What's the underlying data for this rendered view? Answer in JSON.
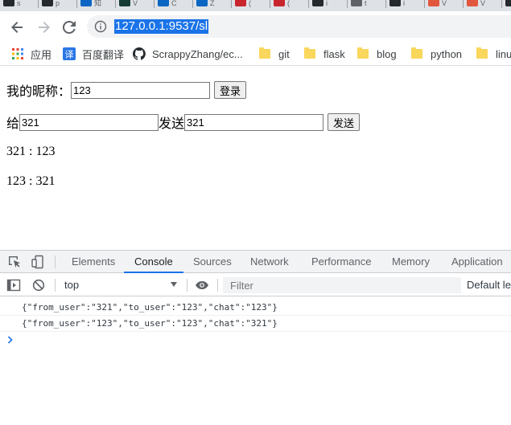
{
  "browser": {
    "tabs": [
      {
        "title": "s",
        "color": "#24292e"
      },
      {
        "title": "p",
        "color": "#24292e"
      },
      {
        "title": "知",
        "color": "#0a66c2"
      },
      {
        "title": "V",
        "color": "#163c35"
      },
      {
        "title": "C",
        "color": "#0a66c2"
      },
      {
        "title": "Z",
        "color": "#0a66c2"
      },
      {
        "title": "(",
        "color": "#c9252c"
      },
      {
        "title": "(",
        "color": "#c9252c"
      },
      {
        "title": "i",
        "color": "#24292e"
      },
      {
        "title": "t",
        "color": "#5f6368"
      },
      {
        "title": "i",
        "color": "#24292e"
      },
      {
        "title": "V",
        "color": "#e1573e"
      },
      {
        "title": "V",
        "color": "#e1573e"
      },
      {
        "title": "",
        "color": "#24292e"
      }
    ],
    "url": "127.0.0.1:9537/sl",
    "bookmarks": {
      "apps_label": "应用",
      "translate_label": "百度翻译",
      "github_label": "ScrappyZhang/ec...",
      "folders": [
        "git",
        "flask",
        "blog",
        "python",
        "linu"
      ]
    }
  },
  "page": {
    "nickname_label": "我的昵称：",
    "nickname_value": "123",
    "login_button": "登录",
    "to_label": "给",
    "to_value": "321",
    "send_label": "发送",
    "message_value": "321",
    "send_button": "发送",
    "messages": [
      "321 : 123",
      "123 : 321"
    ]
  },
  "devtools": {
    "tabs": [
      "Elements",
      "Console",
      "Sources",
      "Network",
      "Performance",
      "Memory",
      "Application"
    ],
    "active_tab": "Console",
    "context": "top",
    "filter_placeholder": "Filter",
    "levels_label": "Default le",
    "console_lines": [
      "{\"from_user\":\"321\",\"to_user\":\"123\",\"chat\":\"123\"}",
      "{\"from_user\":\"123\",\"to_user\":\"123\",\"chat\":\"321\"}"
    ]
  },
  "colors": {
    "accent": "#1a73e8",
    "folder": "#f9d65c"
  }
}
